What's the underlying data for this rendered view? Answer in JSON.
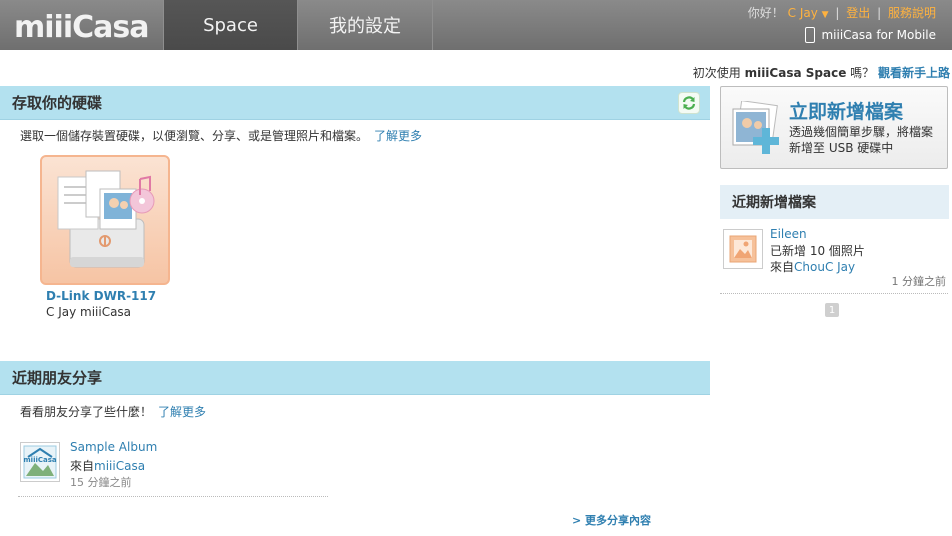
{
  "header": {
    "logo": "miiiCasa",
    "tabs": [
      {
        "label": "Space",
        "active": true
      },
      {
        "label": "我的設定",
        "active": false
      }
    ],
    "greeting": "你好！",
    "user": "C Jay",
    "logout": "登出",
    "help": "服務說明",
    "mobile": "miiiCasa for Mobile"
  },
  "intro": {
    "text_before": "初次使用 ",
    "brand": "miiiCasa Space",
    "text_after": " 嗎？",
    "link": "觀看新手上路"
  },
  "storage": {
    "title": "存取你的硬碟",
    "description": "選取一個儲存裝置硬碟，以便瀏覽、分享、或是管理照片和檔案。",
    "learn_more": "了解更多",
    "device": {
      "name": "D-Link DWR-117",
      "owner": "C Jay miiiCasa"
    }
  },
  "shares": {
    "title": "近期朋友分享",
    "description": "看看朋友分享了些什麼！",
    "learn_more": "了解更多",
    "items": [
      {
        "album": "Sample Album",
        "from_prefix": "來自",
        "from": "miiiCasa",
        "time": "15 分鐘之前",
        "thumb_logo": "miiiCasa"
      }
    ],
    "more": "> 更多分享內容"
  },
  "add_files": {
    "title": "立即新增檔案",
    "description": "透過幾個簡單步驟，將檔案新增至 USB 硬碟中"
  },
  "recent": {
    "title": "近期新增檔案",
    "items": [
      {
        "user": "Eileen",
        "action": "已新增 10 個照片",
        "from_prefix": "來自",
        "from": "ChouC Jay",
        "time": "1 分鐘之前"
      }
    ],
    "page": "1"
  },
  "colors": {
    "accent": "#2f7fb0",
    "user_link": "#ffb23f",
    "section_bar": "#b3e1ef",
    "card_border": "#f5b58f"
  }
}
